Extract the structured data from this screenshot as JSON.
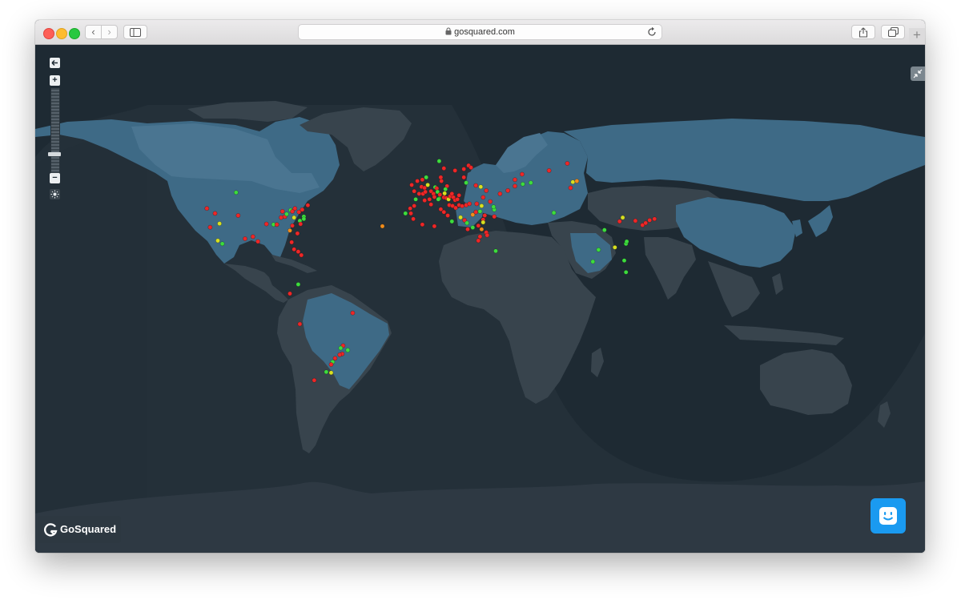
{
  "browser": {
    "address": "gosquared.com",
    "back_glyph": "‹",
    "forward_glyph": "›",
    "new_tab_glyph": "+"
  },
  "map_controls": {
    "zoom_in": "+",
    "zoom_out": "−",
    "zoom_level": 0.3
  },
  "brand": {
    "name": "GoSquared"
  },
  "colors": {
    "ocean": "#1e2a33",
    "land_night": "#38444d",
    "land_active": "#46718c",
    "visitor_red": "#ee2727",
    "visitor_green": "#3ddc3d",
    "visitor_yellow": "#d8e020",
    "visitor_orange": "#f08c1c",
    "chat_blue": "#1a9af0"
  },
  "visitors": [
    {
      "lon": -103.8,
      "lat": 51.9,
      "status": "green"
    },
    {
      "lon": -120.6,
      "lat": 44.2,
      "status": "red"
    },
    {
      "lon": -115.9,
      "lat": 41.7,
      "status": "red"
    },
    {
      "lon": -102.6,
      "lat": 40.6,
      "status": "red"
    },
    {
      "lon": -113.3,
      "lat": 36.3,
      "status": "yellow"
    },
    {
      "lon": -118.7,
      "lat": 34.3,
      "status": "red"
    },
    {
      "lon": -111.7,
      "lat": 25.0,
      "status": "green"
    },
    {
      "lon": -114.3,
      "lat": 26.8,
      "status": "yellow"
    },
    {
      "lon": -98.6,
      "lat": 27.9,
      "status": "red"
    },
    {
      "lon": -94.1,
      "lat": 29.1,
      "status": "red"
    },
    {
      "lon": -91.2,
      "lat": 26.3,
      "status": "red"
    },
    {
      "lon": -86.3,
      "lat": 36.1,
      "status": "red"
    },
    {
      "lon": -82.2,
      "lat": 35.8,
      "status": "green"
    },
    {
      "lon": -80.3,
      "lat": 35.8,
      "status": "red"
    },
    {
      "lon": -77.9,
      "lat": 39.5,
      "status": "red"
    },
    {
      "lon": -75.7,
      "lat": 40.0,
      "status": "red"
    },
    {
      "lon": -74.7,
      "lat": 41.3,
      "status": "green"
    },
    {
      "lon": -77.1,
      "lat": 42.7,
      "status": "red"
    },
    {
      "lon": -72.4,
      "lat": 43.3,
      "status": "green"
    },
    {
      "lon": -71.4,
      "lat": 42.7,
      "status": "red"
    },
    {
      "lon": -69.9,
      "lat": 44.2,
      "status": "red"
    },
    {
      "lon": -67.6,
      "lat": 42.4,
      "status": "red"
    },
    {
      "lon": -65.7,
      "lat": 43.6,
      "status": "red"
    },
    {
      "lon": -62.5,
      "lat": 45.8,
      "status": "red"
    },
    {
      "lon": -64.8,
      "lat": 40.0,
      "status": "green"
    },
    {
      "lon": -64.8,
      "lat": 38.8,
      "status": "green"
    },
    {
      "lon": -67.1,
      "lat": 37.8,
      "status": "green"
    },
    {
      "lon": -66.7,
      "lat": 36.1,
      "status": "red"
    },
    {
      "lon": -70.4,
      "lat": 39.5,
      "status": "yellow"
    },
    {
      "lon": -71.4,
      "lat": 35.2,
      "status": "red"
    },
    {
      "lon": -72.8,
      "lat": 32.5,
      "status": "orange"
    },
    {
      "lon": -68.5,
      "lat": 30.9,
      "status": "red"
    },
    {
      "lon": -71.8,
      "lat": 25.9,
      "status": "red"
    },
    {
      "lon": -70.4,
      "lat": 21.8,
      "status": "red"
    },
    {
      "lon": -68.0,
      "lat": 20.4,
      "status": "red"
    },
    {
      "lon": -66.2,
      "lat": 18.3,
      "status": "red"
    },
    {
      "lon": -68.0,
      "lat": 0.5,
      "status": "green"
    },
    {
      "lon": -72.8,
      "lat": -5.2,
      "status": "red"
    },
    {
      "lon": -67.1,
      "lat": -23.5,
      "status": "red"
    },
    {
      "lon": -36.7,
      "lat": -17.0,
      "status": "red"
    },
    {
      "lon": -42.2,
      "lat": -35.7,
      "status": "red"
    },
    {
      "lon": -43.6,
      "lat": -37.0,
      "status": "green"
    },
    {
      "lon": -39.5,
      "lat": -38.1,
      "status": "green"
    },
    {
      "lon": -42.7,
      "lat": -40.1,
      "status": "red"
    },
    {
      "lon": -44.1,
      "lat": -40.5,
      "status": "red"
    },
    {
      "lon": -46.8,
      "lat": -42.4,
      "status": "red"
    },
    {
      "lon": -48.2,
      "lat": -44.2,
      "status": "green"
    },
    {
      "lon": -49.1,
      "lat": -45.5,
      "status": "red"
    },
    {
      "lon": -49.1,
      "lat": -49.5,
      "status": "yellow"
    },
    {
      "lon": -51.9,
      "lat": -49.1,
      "status": "green"
    },
    {
      "lon": -58.8,
      "lat": -53.0,
      "status": "red"
    },
    {
      "lon": -19.6,
      "lat": 34.9,
      "status": "orange"
    },
    {
      "lon": -6.3,
      "lat": 41.7,
      "status": "green"
    },
    {
      "lon": 2.9,
      "lat": 54.5,
      "status": "red"
    },
    {
      "lon": 3.8,
      "lat": 51.3,
      "status": "red"
    },
    {
      "lon": 4.7,
      "lat": 54.0,
      "status": "red"
    },
    {
      "lon": 6.5,
      "lat": 55.3,
      "status": "yellow"
    },
    {
      "lon": 5.1,
      "lat": 52.2,
      "status": "red"
    },
    {
      "lon": 8.4,
      "lat": 52.5,
      "status": "red"
    },
    {
      "lon": 9.8,
      "lat": 51.3,
      "status": "red"
    },
    {
      "lon": 10.8,
      "lat": 54.3,
      "status": "green"
    },
    {
      "lon": 11.7,
      "lat": 53.8,
      "status": "red"
    },
    {
      "lon": 12.1,
      "lat": 52.2,
      "status": "green"
    },
    {
      "lon": 14.4,
      "lat": 57.0,
      "status": "red"
    },
    {
      "lon": 14.0,
      "lat": 58.6,
      "status": "red"
    },
    {
      "lon": 17.6,
      "lat": 54.8,
      "status": "red"
    },
    {
      "lon": 16.7,
      "lat": 53.4,
      "status": "green"
    },
    {
      "lon": 16.2,
      "lat": 51.5,
      "status": "yellow"
    },
    {
      "lon": 13.5,
      "lat": 50.9,
      "status": "red"
    },
    {
      "lon": 13.0,
      "lat": 49.0,
      "status": "green"
    },
    {
      "lon": 7.5,
      "lat": 48.7,
      "status": "red"
    },
    {
      "lon": 4.7,
      "lat": 48.2,
      "status": "red"
    },
    {
      "lon": 8.4,
      "lat": 46.2,
      "status": "red"
    },
    {
      "lon": 10.3,
      "lat": 49.8,
      "status": "red"
    },
    {
      "lon": 12.6,
      "lat": 48.7,
      "status": "green"
    },
    {
      "lon": 15.8,
      "lat": 49.6,
      "status": "red"
    },
    {
      "lon": 17.2,
      "lat": 49.3,
      "status": "red"
    },
    {
      "lon": 18.5,
      "lat": 48.7,
      "status": "yellow"
    },
    {
      "lon": 19.4,
      "lat": 50.1,
      "status": "red"
    },
    {
      "lon": 20.4,
      "lat": 51.3,
      "status": "red"
    },
    {
      "lon": 21.3,
      "lat": 49.6,
      "status": "red"
    },
    {
      "lon": 22.2,
      "lat": 48.3,
      "status": "red"
    },
    {
      "lon": 23.6,
      "lat": 48.7,
      "status": "red"
    },
    {
      "lon": 24.5,
      "lat": 50.6,
      "status": "red"
    },
    {
      "lon": 18.9,
      "lat": 45.9,
      "status": "red"
    },
    {
      "lon": 20.8,
      "lat": 45.5,
      "status": "red"
    },
    {
      "lon": 22.6,
      "lat": 44.5,
      "status": "red"
    },
    {
      "lon": 24.5,
      "lat": 45.9,
      "status": "red"
    },
    {
      "lon": 26.3,
      "lat": 45.4,
      "status": "red"
    },
    {
      "lon": 28.6,
      "lat": 45.9,
      "status": "red"
    },
    {
      "lon": 30.5,
      "lat": 46.5,
      "status": "red"
    },
    {
      "lon": 14.0,
      "lat": 43.8,
      "status": "red"
    },
    {
      "lon": 15.8,
      "lat": 42.4,
      "status": "red"
    },
    {
      "lon": 18.0,
      "lat": 40.6,
      "status": "red"
    },
    {
      "lon": 20.4,
      "lat": 37.5,
      "status": "green"
    },
    {
      "lon": 25.4,
      "lat": 39.6,
      "status": "yellow"
    },
    {
      "lon": 27.7,
      "lat": 38.1,
      "status": "red"
    },
    {
      "lon": 29.1,
      "lat": 36.6,
      "status": "green"
    },
    {
      "lon": 32.4,
      "lat": 41.0,
      "status": "orange"
    },
    {
      "lon": 34.2,
      "lat": 42.4,
      "status": "red"
    },
    {
      "lon": 35.6,
      "lat": 35.2,
      "status": "red"
    },
    {
      "lon": 37.5,
      "lat": 33.2,
      "status": "orange"
    },
    {
      "lon": 40.2,
      "lat": 31.5,
      "status": "red"
    },
    {
      "lon": 40.7,
      "lat": 29.9,
      "status": "red"
    },
    {
      "lon": 10.3,
      "lat": 34.9,
      "status": "red"
    },
    {
      "lon": 3.4,
      "lat": 35.8,
      "status": "red"
    },
    {
      "lon": -1.8,
      "lat": 38.8,
      "status": "red"
    },
    {
      "lon": -3.2,
      "lat": 41.7,
      "status": "red"
    },
    {
      "lon": -3.6,
      "lat": 44.2,
      "status": "red"
    },
    {
      "lon": -1.3,
      "lat": 45.5,
      "status": "red"
    },
    {
      "lon": -0.4,
      "lat": 48.7,
      "status": "green"
    },
    {
      "lon": 1.5,
      "lat": 51.3,
      "status": "red"
    },
    {
      "lon": -1.3,
      "lat": 52.5,
      "status": "red"
    },
    {
      "lon": -2.7,
      "lat": 55.3,
      "status": "red"
    },
    {
      "lon": 0.5,
      "lat": 57.0,
      "status": "red"
    },
    {
      "lon": 3.4,
      "lat": 57.6,
      "status": "red"
    },
    {
      "lon": 5.6,
      "lat": 58.6,
      "status": "green"
    },
    {
      "lon": 13.1,
      "lat": 65.1,
      "status": "green"
    },
    {
      "lon": 15.8,
      "lat": 62.3,
      "status": "red"
    },
    {
      "lon": 22.2,
      "lat": 61.4,
      "status": "red"
    },
    {
      "lon": 27.3,
      "lat": 62.0,
      "status": "red"
    },
    {
      "lon": 30.0,
      "lat": 63.4,
      "status": "red"
    },
    {
      "lon": 31.4,
      "lat": 62.6,
      "status": "red"
    },
    {
      "lon": 27.3,
      "lat": 58.6,
      "status": "red"
    },
    {
      "lon": 28.6,
      "lat": 56.3,
      "status": "green"
    },
    {
      "lon": 34.2,
      "lat": 55.1,
      "status": "red"
    },
    {
      "lon": 37.0,
      "lat": 54.5,
      "status": "yellow"
    },
    {
      "lon": 40.2,
      "lat": 52.8,
      "status": "red"
    },
    {
      "lon": 38.4,
      "lat": 49.6,
      "status": "red"
    },
    {
      "lon": 34.7,
      "lat": 46.5,
      "status": "red"
    },
    {
      "lon": 37.5,
      "lat": 45.5,
      "status": "yellow"
    },
    {
      "lon": 36.6,
      "lat": 42.7,
      "status": "green"
    },
    {
      "lon": 44.8,
      "lat": 43.6,
      "status": "green"
    },
    {
      "lon": 39.3,
      "lat": 40.6,
      "status": "red"
    },
    {
      "lon": 38.4,
      "lat": 38.4,
      "status": "red"
    },
    {
      "lon": 38.4,
      "lat": 37.0,
      "status": "yellow"
    },
    {
      "lon": 32.4,
      "lat": 34.2,
      "status": "green"
    },
    {
      "lon": 29.5,
      "lat": 33.2,
      "status": "red"
    },
    {
      "lon": 42.5,
      "lat": 47.6,
      "status": "red"
    },
    {
      "lon": 44.4,
      "lat": 45.0,
      "status": "green"
    },
    {
      "lon": 44.8,
      "lat": 40.0,
      "status": "red"
    },
    {
      "lon": 36.6,
      "lat": 29.1,
      "status": "red"
    },
    {
      "lon": 35.6,
      "lat": 26.8,
      "status": "red"
    },
    {
      "lon": 45.6,
      "lat": 20.8,
      "status": "green"
    },
    {
      "lon": 48.1,
      "lat": 51.3,
      "status": "red"
    },
    {
      "lon": 52.6,
      "lat": 52.8,
      "status": "red"
    },
    {
      "lon": 56.7,
      "lat": 54.8,
      "status": "red"
    },
    {
      "lon": 56.7,
      "lat": 57.6,
      "status": "red"
    },
    {
      "lon": 60.8,
      "lat": 59.9,
      "status": "red"
    },
    {
      "lon": 61.2,
      "lat": 55.7,
      "status": "green"
    },
    {
      "lon": 65.8,
      "lat": 56.3,
      "status": "green"
    },
    {
      "lon": 76.3,
      "lat": 61.4,
      "status": "red"
    },
    {
      "lon": 86.8,
      "lat": 64.2,
      "status": "red"
    },
    {
      "lon": 79.1,
      "lat": 42.0,
      "status": "green"
    },
    {
      "lon": 88.7,
      "lat": 54.0,
      "status": "red"
    },
    {
      "lon": 90.0,
      "lat": 56.6,
      "status": "yellow"
    },
    {
      "lon": 92.3,
      "lat": 57.0,
      "status": "orange"
    },
    {
      "lon": 108.2,
      "lat": 32.8,
      "status": "green"
    },
    {
      "lon": 116.9,
      "lat": 37.5,
      "status": "red"
    },
    {
      "lon": 118.7,
      "lat": 39.5,
      "status": "yellow"
    },
    {
      "lon": 126.0,
      "lat": 37.8,
      "status": "red"
    },
    {
      "lon": 130.1,
      "lat": 35.5,
      "status": "red"
    },
    {
      "lon": 131.9,
      "lat": 36.6,
      "status": "red"
    },
    {
      "lon": 134.2,
      "lat": 38.1,
      "status": "red"
    },
    {
      "lon": 137.0,
      "lat": 38.8,
      "status": "red"
    },
    {
      "lon": 114.2,
      "lat": 22.9,
      "status": "yellow"
    },
    {
      "lon": 120.6,
      "lat": 25.0,
      "status": "green"
    },
    {
      "lon": 121.0,
      "lat": 26.3,
      "status": "green"
    },
    {
      "lon": 104.8,
      "lat": 21.5,
      "status": "green"
    },
    {
      "lon": 101.5,
      "lat": 14.4,
      "status": "green"
    },
    {
      "lon": 119.6,
      "lat": 15.1,
      "status": "green"
    },
    {
      "lon": 120.6,
      "lat": 8.0,
      "status": "green"
    }
  ]
}
